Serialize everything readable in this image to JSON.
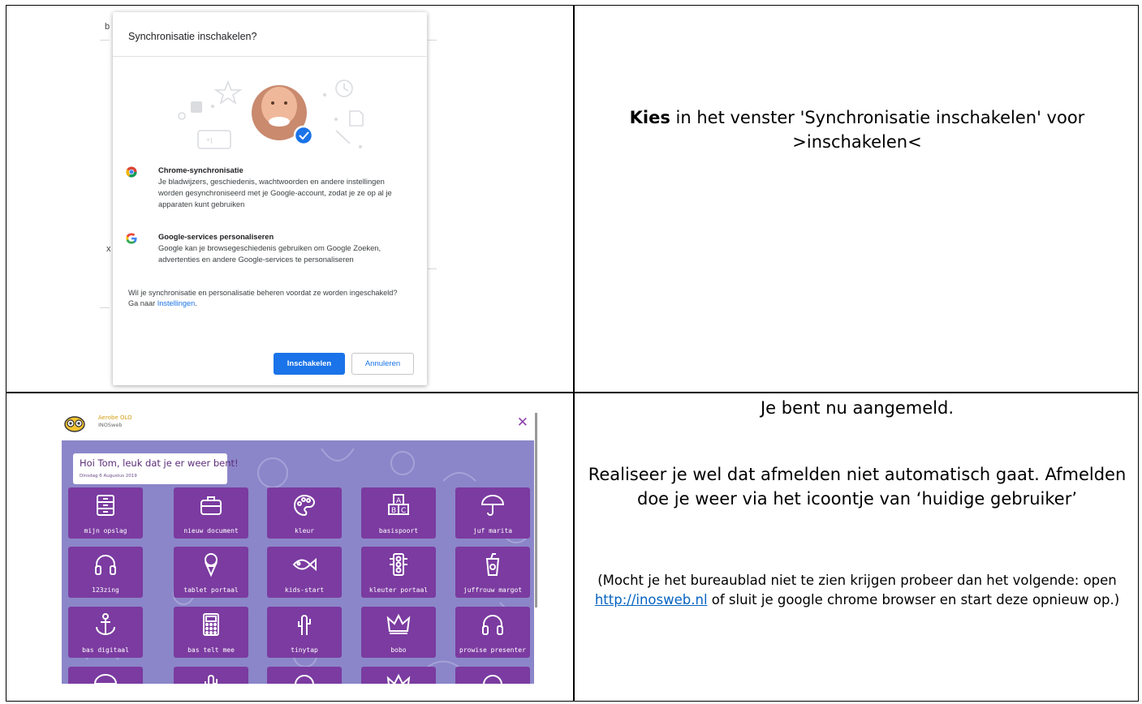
{
  "sync_dialog": {
    "title": "Synchronisatie inschakelen?",
    "chrome_sync_title": "Chrome-synchronisatie",
    "chrome_sync_body": "Je bladwijzers, geschiedenis, wachtwoorden en andere instellingen worden gesynchroniseerd met je Google-account, zodat je ze op al je apparaten kunt gebruiken",
    "personalize_title": "Google-services personaliseren",
    "personalize_body": "Google kan je browsegeschiedenis gebruiken om Google Zoeken, advertenties en andere Google-services te personaliseren",
    "note_prefix": "Wil je synchronisatie en personalisatie beheren voordat ze worden ingeschakeld? Ga naar ",
    "note_link": "Instellingen",
    "note_suffix": ".",
    "primary_button": "Inschakelen",
    "secondary_button": "Annuleren",
    "accent_color": "#1a73e8"
  },
  "instruction_top": {
    "bold": "Kies",
    "rest": " in het venster 'Synchronisatie inschakelen' voor >inschakelen<"
  },
  "instruction_bottom": {
    "line1": "Je bent nu aangemeld.",
    "line2": "Realiseer je wel dat afmelden niet automatisch gaat. Afmelden doe je weer via het icoontje van ‘huidige gebruiker’",
    "line3_prefix": "(Mocht je het bureaublad niet te zien krijgen probeer dan het volgende: open ",
    "line3_link": "http://inosweb.nl",
    "line3_suffix": " of sluit je google chrome browser en start deze opnieuw op.)"
  },
  "desktop": {
    "brand": "Aerobe OLO",
    "brand_sub": "INOSweb",
    "greeting": "Hoi Tom, leuk dat je er weer bent!",
    "date": "Dinsdag 6 Augustus 2019",
    "tile_color": "#7b3ba0",
    "background_color": "#8b86c9",
    "tiles": [
      {
        "label": "mijn opslag",
        "icon": "drawer-icon"
      },
      {
        "label": "nieuw document",
        "icon": "briefcase-icon"
      },
      {
        "label": "kleur",
        "icon": "palette-icon"
      },
      {
        "label": "basispoort",
        "icon": "abc-blocks-icon"
      },
      {
        "label": "juf marita",
        "icon": "umbrella-icon"
      },
      {
        "label": "123zing",
        "icon": "headphones-icon"
      },
      {
        "label": "tablet portaal",
        "icon": "ice-cream-icon"
      },
      {
        "label": "kids-start",
        "icon": "fish-icon"
      },
      {
        "label": "kleuter portaal",
        "icon": "traffic-light-icon"
      },
      {
        "label": "juffrouw margot",
        "icon": "cup-icon"
      },
      {
        "label": "bas digitaal",
        "icon": "anchor-icon"
      },
      {
        "label": "bas telt mee",
        "icon": "calculator-icon"
      },
      {
        "label": "tinytap",
        "icon": "cactus-icon"
      },
      {
        "label": "bobo",
        "icon": "crown-icon"
      },
      {
        "label": "prowise presenter",
        "icon": "headphones-icon"
      }
    ]
  }
}
